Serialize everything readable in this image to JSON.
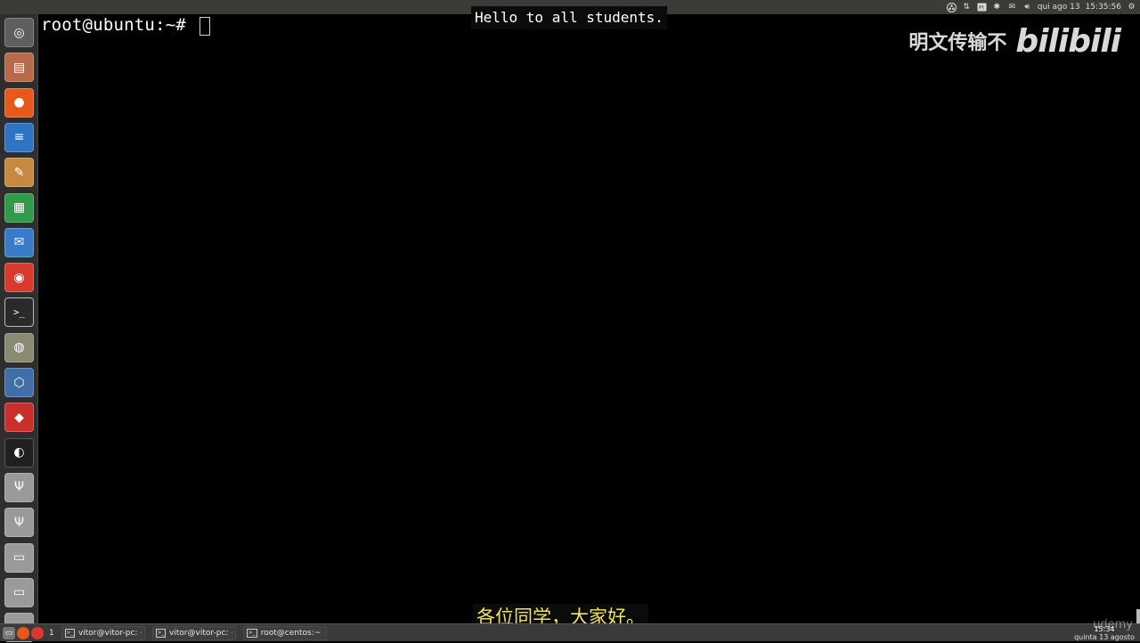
{
  "top_panel": {
    "date": "qui ago 13",
    "time": "15:35:56"
  },
  "terminal": {
    "prompt": "root@ubuntu:~# "
  },
  "subtitles": {
    "top": "Hello to all students.",
    "bottom": "各位同学，大家好。"
  },
  "watermark": {
    "text": "明文传输不",
    "logo": "bilibili"
  },
  "launcher": {
    "items": [
      {
        "icon": "ubuntu-dash-icon",
        "color": "#5e5e5e"
      },
      {
        "icon": "files-cabinet-icon",
        "color": "#b96a4b"
      },
      {
        "icon": "firefox-icon",
        "color": "#e8581d"
      },
      {
        "icon": "writer-document-icon",
        "color": "#2f73c4"
      },
      {
        "icon": "text-editor-icon",
        "color": "#c58a40"
      },
      {
        "icon": "calc-spreadsheet-icon",
        "color": "#2f9a47"
      },
      {
        "icon": "thunderbird-mail-icon",
        "color": "#3a7bc8"
      },
      {
        "icon": "chrome-icon",
        "color": "#d93a2e"
      },
      {
        "icon": "terminal-icon",
        "color": "#2a2a2a"
      },
      {
        "icon": "camera-app-icon",
        "color": "#8a8a72"
      },
      {
        "icon": "virtualbox-icon",
        "color": "#3f6ea8"
      },
      {
        "icon": "kali-64-icon",
        "color": "#c9302c"
      },
      {
        "icon": "obs-studio-icon",
        "color": "#202020"
      },
      {
        "icon": "usb-drive-icon",
        "color": "#9a9a9a"
      },
      {
        "icon": "usb-drive-icon",
        "color": "#9a9a9a"
      },
      {
        "icon": "disk-drive-icon",
        "color": "#9a9a9a"
      },
      {
        "icon": "disk-drive-icon",
        "color": "#9a9a9a"
      },
      {
        "icon": "disk-drive-icon",
        "color": "#9a9a9a"
      }
    ]
  },
  "taskbar": {
    "workspace": "1",
    "tasks": [
      {
        "label": "vitor@vitor-pc: ~"
      },
      {
        "label": "vitor@vitor-pc: ~"
      },
      {
        "label": "root@centos:~"
      }
    ],
    "clock_time": "15:34",
    "clock_date": "quinta 13 agosto"
  },
  "brand_mark": "udemy"
}
